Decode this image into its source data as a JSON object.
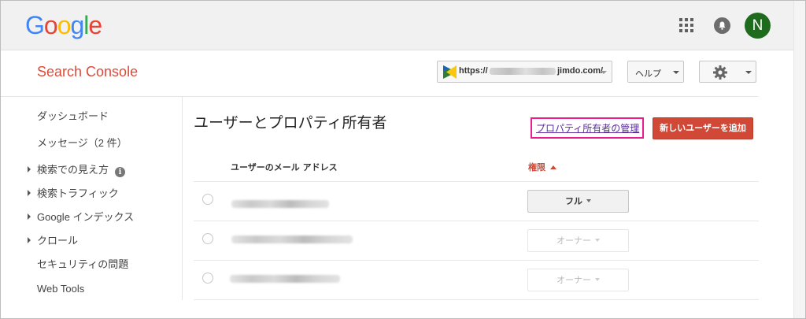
{
  "topbar": {
    "logo": {
      "letters": [
        "G",
        "o",
        "o",
        "g",
        "l",
        "e"
      ],
      "colors": [
        "#4285f4",
        "#ea4335",
        "#fbbc05",
        "#4285f4",
        "#34a853",
        "#ea4335"
      ]
    },
    "avatar_letter": "N",
    "avatar_color": "#1e6b1e"
  },
  "header": {
    "app_title": "Search Console",
    "property_url": "https://",
    "property_url_suffix": "jimdo.com/",
    "help_label": "ヘルプ"
  },
  "sidebar": {
    "items": [
      {
        "label": "ダッシュボード",
        "has_arrow": false,
        "has_info": false
      },
      {
        "label": "メッセージ（2 件）",
        "has_arrow": false,
        "has_info": false
      },
      {
        "label": "検索での見え方",
        "has_arrow": true,
        "has_info": true
      },
      {
        "label": "検索トラフィック",
        "has_arrow": true,
        "has_info": false
      },
      {
        "label": "Google インデックス",
        "has_arrow": true,
        "has_info": false
      },
      {
        "label": "クロール",
        "has_arrow": true,
        "has_info": false
      },
      {
        "label": "セキュリティの問題",
        "has_arrow": false,
        "has_info": false
      },
      {
        "label": "Web Tools",
        "has_arrow": false,
        "has_info": false
      }
    ],
    "info_glyph": "i"
  },
  "main": {
    "page_title": "ユーザーとプロパティ所有者",
    "manage_owners_link": "プロパティ所有者の管理",
    "add_user_button": "新しいユーザーを追加",
    "columns": {
      "email": "ユーザーのメール アドレス",
      "permission": "権限"
    },
    "rows": [
      {
        "permission": "フル",
        "state": "active"
      },
      {
        "permission": "オーナー",
        "state": "disabled"
      },
      {
        "permission": "オーナー",
        "state": "disabled"
      }
    ]
  },
  "colors": {
    "brand_red": "#dd4b39",
    "button_red": "#d14836",
    "highlight_pink": "#e91e8c"
  }
}
